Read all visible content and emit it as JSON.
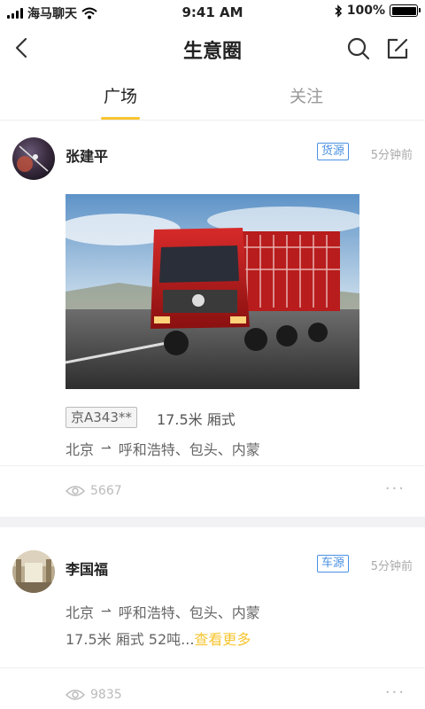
{
  "status_bar": {
    "carrier": "海马聊天",
    "time": "9:41 AM",
    "battery_percent": "100%",
    "battery_level": 1.0,
    "icons": [
      "signal-icon",
      "wifi-icon",
      "bluetooth-icon",
      "battery-icon"
    ]
  },
  "nav": {
    "title": "生意圈",
    "icons": [
      "back-icon",
      "search-icon",
      "compose-icon"
    ]
  },
  "tabs": [
    {
      "label": "广场",
      "active": true
    },
    {
      "label": "关注",
      "active": false
    }
  ],
  "posts": [
    {
      "author": "张建平",
      "tag": "货源",
      "time": "5分钟前",
      "plate": "京A343**",
      "specs": "17.5米  厢式",
      "route_from": "北京",
      "route_to": "呼和浩特、包头、内蒙",
      "views": "5667"
    },
    {
      "author": "李国福",
      "tag": "车源",
      "time": "5分钟前",
      "route_from": "北京",
      "route_to": "呼和浩特、包头、内蒙",
      "desc": "17.5米  厢式  52吨...",
      "see_more": "查看更多",
      "views": "9835"
    }
  ],
  "colors": {
    "accent": "#f7c531",
    "tag_blue": "#4a90e2",
    "muted": "#aaaaaa"
  }
}
